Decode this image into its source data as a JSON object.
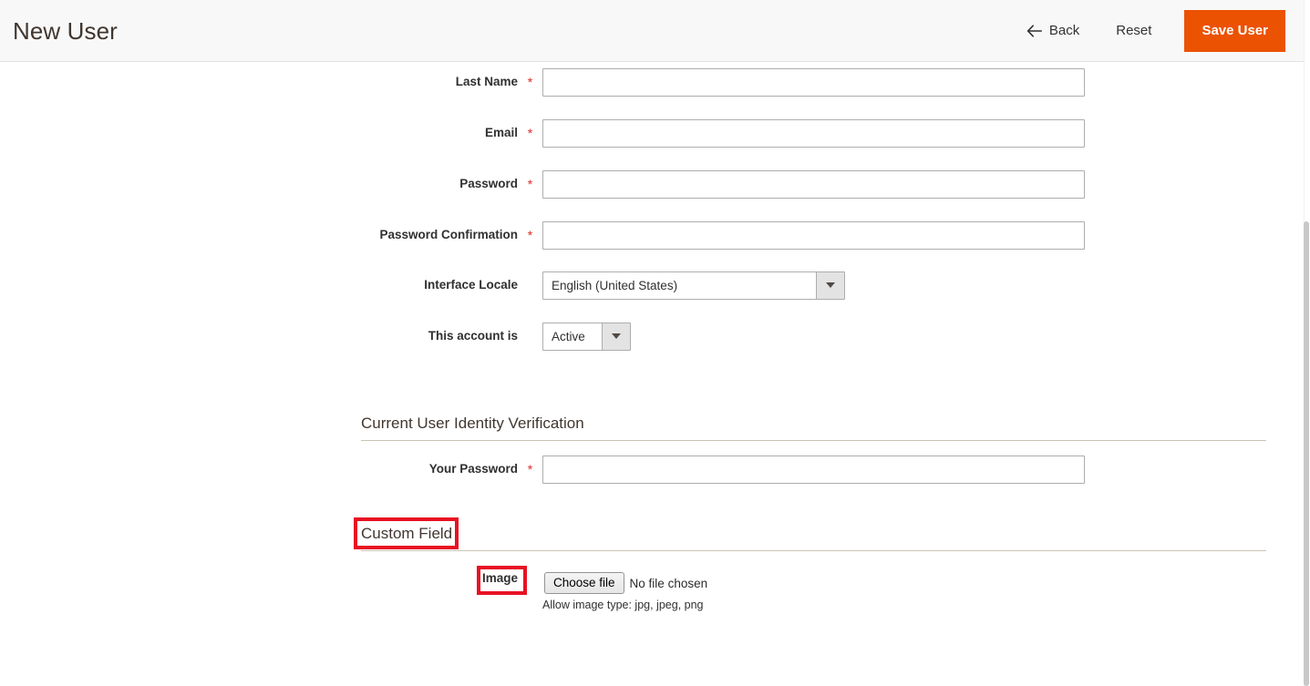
{
  "header": {
    "title": "New User",
    "back_label": "Back",
    "back_icon": "arrow-left-icon",
    "reset_label": "Reset",
    "save_label": "Save User",
    "save_color": "#eb5202"
  },
  "form": {
    "required_marker": "*",
    "fields": [
      {
        "label": "Last Name",
        "required": true,
        "type": "text",
        "value": ""
      },
      {
        "label": "Email",
        "required": true,
        "type": "text",
        "value": ""
      },
      {
        "label": "Password",
        "required": true,
        "type": "password",
        "value": ""
      },
      {
        "label": "Password Confirmation",
        "required": true,
        "type": "password",
        "value": ""
      },
      {
        "label": "Interface Locale",
        "required": false,
        "type": "select",
        "value": "English (United States)"
      },
      {
        "label": "This account is",
        "required": false,
        "type": "select",
        "value": "Active"
      }
    ]
  },
  "verification_section": {
    "heading": "Current User Identity Verification",
    "field": {
      "label": "Your Password",
      "required": true,
      "value": ""
    }
  },
  "custom_field_section": {
    "heading": "Custom Field",
    "image_label": "Image",
    "choose_file_label": "Choose file",
    "no_file_text": "No file chosen",
    "note": "Allow image type: jpg, jpeg, png"
  },
  "annotations": {
    "color": "#e81123",
    "boxes": [
      {
        "target": "custom-field-heading"
      },
      {
        "target": "image-label"
      }
    ]
  }
}
